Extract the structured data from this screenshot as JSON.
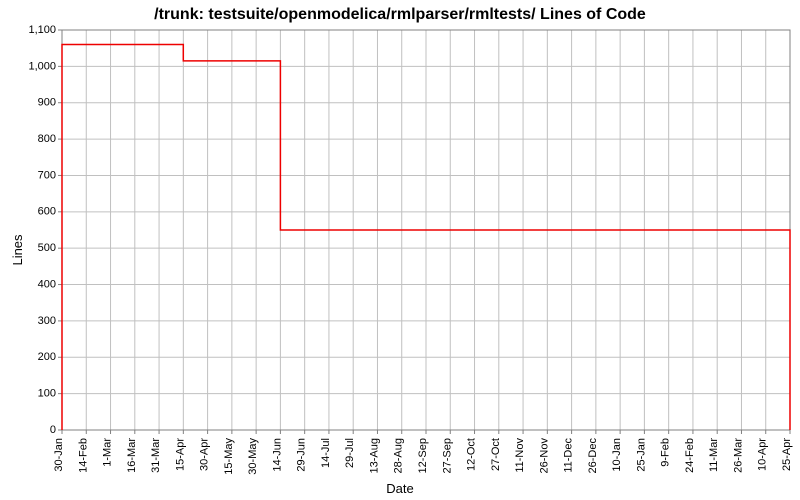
{
  "chart_data": {
    "type": "line",
    "title": "/trunk: testsuite/openmodelica/rmlparser/rmltests/ Lines of Code",
    "xlabel": "Date",
    "ylabel": "Lines",
    "ylim": [
      0,
      1100
    ],
    "y_ticks": [
      0,
      100,
      200,
      300,
      400,
      500,
      600,
      700,
      800,
      900,
      1000,
      1100
    ],
    "y_tick_labels": [
      "0",
      "100",
      "200",
      "300",
      "400",
      "500",
      "600",
      "700",
      "800",
      "900",
      "1,000",
      "1,100"
    ],
    "x_tick_labels": [
      "30-Jan",
      "14-Feb",
      "1-Mar",
      "16-Mar",
      "31-Mar",
      "15-Apr",
      "30-Apr",
      "15-May",
      "30-May",
      "14-Jun",
      "29-Jun",
      "14-Jul",
      "29-Jul",
      "13-Aug",
      "28-Aug",
      "12-Sep",
      "27-Sep",
      "12-Oct",
      "27-Oct",
      "11-Nov",
      "26-Nov",
      "11-Dec",
      "26-Dec",
      "10-Jan",
      "25-Jan",
      "9-Feb",
      "24-Feb",
      "11-Mar",
      "26-Mar",
      "10-Apr",
      "25-Apr"
    ],
    "series": [
      {
        "name": "Lines of Code",
        "color": "#ee0000",
        "points": [
          {
            "xi": 0,
            "y": 0
          },
          {
            "xi": 0,
            "y": 1060
          },
          {
            "xi": 5,
            "y": 1060
          },
          {
            "xi": 5,
            "y": 1015
          },
          {
            "xi": 9,
            "y": 1015
          },
          {
            "xi": 9,
            "y": 550
          },
          {
            "xi": 30,
            "y": 550
          },
          {
            "xi": 30,
            "y": 0
          }
        ]
      }
    ]
  }
}
